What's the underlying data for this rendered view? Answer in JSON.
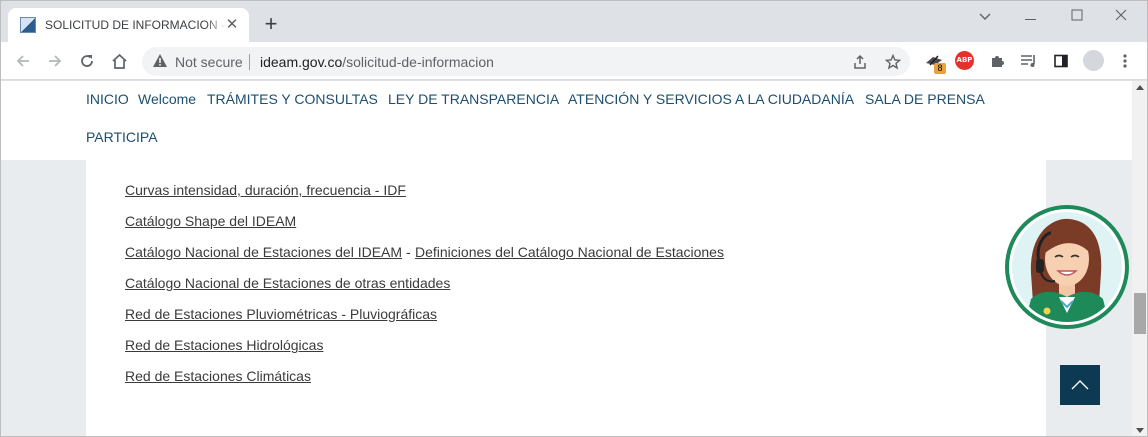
{
  "browser": {
    "tab_title": "SOLICITUD DE INFORMACION - IDEAM",
    "tab_close_glyph": "✕",
    "new_tab_glyph": "+",
    "security_label": "Not secure",
    "url_domain": "ideam.gov.co",
    "url_path": "/solicitud-de-informacion",
    "extension_badge": "8",
    "adblock_label": "ABP",
    "window_controls": {
      "minimize": "—",
      "maximize": "☐",
      "close": "✕",
      "tab_search": "⌄"
    }
  },
  "nav": {
    "items": [
      "INICIO",
      "Welcome",
      "TRÁMITES Y CONSULTAS",
      "LEY DE TRANSPARENCIA",
      "ATENCIÓN Y SERVICIOS A LA CIUDADANÍA",
      "SALA DE PRENSA",
      "PARTICIPA"
    ]
  },
  "content": {
    "links": [
      "Curvas intensidad, duración, frecuencia - IDF",
      "Catálogo Shape del IDEAM",
      "Catálogo Nacional de Estaciones del IDEAM",
      "Catálogo Nacional de Estaciones de otras entidades",
      "Red de Estaciones Pluviométricas - Pluviográficas",
      "Red de Estaciones Hidrológicas",
      "Red de Estaciones Climáticas"
    ],
    "link_separator": "-",
    "secondary_link": "Definiciones del Catálogo Nacional de Estaciones"
  },
  "colors": {
    "nav_text": "#1c4f6e",
    "link_text": "#3b3b3b",
    "scroll_top_bg": "#0b3a52",
    "assistant_ring": "#1e8a5a"
  },
  "icons": {
    "back": "arrow-left-icon",
    "forward": "arrow-right-icon",
    "reload": "reload-icon",
    "home": "home-icon",
    "warning": "warning-icon",
    "share": "share-icon",
    "bookmark": "star-icon",
    "extensions": "puzzle-icon",
    "media": "media-queue-icon",
    "side_panel": "side-panel-icon",
    "menu": "kebab-menu-icon",
    "scroll_top": "chevron-up-icon",
    "assistant": "virtual-assistant-icon"
  }
}
